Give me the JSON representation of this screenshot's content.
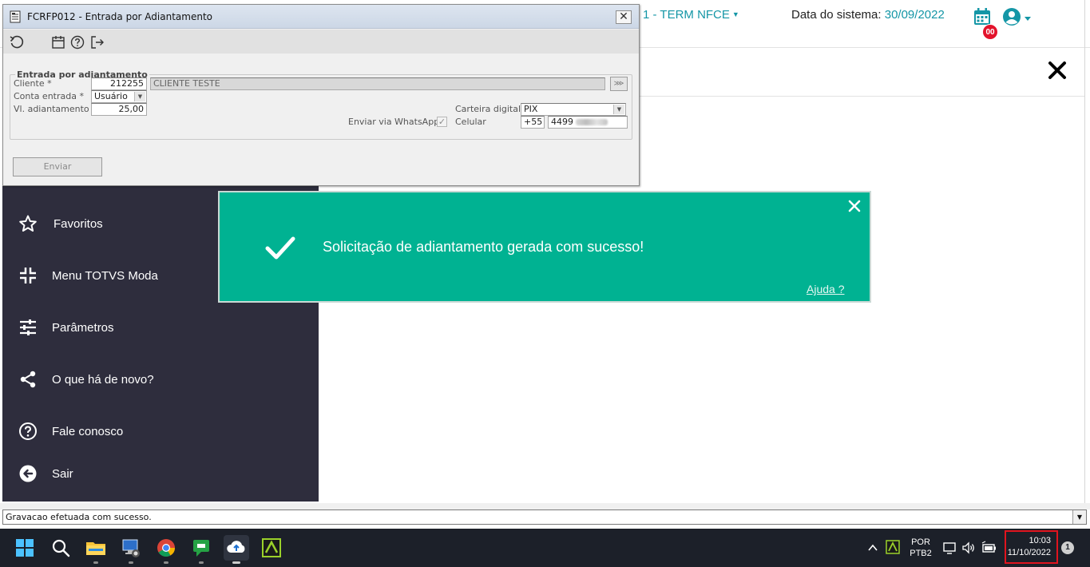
{
  "header": {
    "terminal_label": "1 - TERM NFCE",
    "system_date_label": "Data do sistema:",
    "system_date_value": "30/09/2022",
    "notification_badge": "00"
  },
  "legacy_window": {
    "title": "FCRFP012 - Entrada por Adiantamento",
    "group_title": "Entrada por adiantamento",
    "fields": {
      "cliente_label": "Cliente *",
      "cliente_code": "212255",
      "cliente_name": "CLIENTE TESTE",
      "conta_label": "Conta entrada *",
      "conta_value": "Usuário",
      "valor_label": "Vl. adiantamento *",
      "valor_value": "25,00",
      "carteira_label": "Carteira digital",
      "carteira_value": "PIX",
      "whatsapp_label": "Enviar via WhatsApp",
      "celular_label": "Celular",
      "celular_ddi": "+55",
      "celular_number": "4499"
    },
    "send_button": "Enviar"
  },
  "sidebar": {
    "items": [
      {
        "label": "Favoritos"
      },
      {
        "label": "Menu TOTVS Moda"
      },
      {
        "label": "Parâmetros"
      },
      {
        "label": "O que há de novo?"
      },
      {
        "label": "Fale conosco"
      },
      {
        "label": "Sair"
      }
    ]
  },
  "toast": {
    "message": "Solicitação de adiantamento gerada com sucesso!",
    "help_link": "Ajuda ?",
    "color": "#00b292"
  },
  "statusbar": {
    "text": "Gravacao efetuada com sucesso."
  },
  "taskbar": {
    "lang_top": "POR",
    "lang_bottom": "PTB2",
    "time": "10:03",
    "date": "11/10/2022",
    "notifications": "1"
  },
  "colors": {
    "accent": "#1496a6",
    "sidebar_bg": "#2e2d3d",
    "badge": "#e3132c"
  }
}
